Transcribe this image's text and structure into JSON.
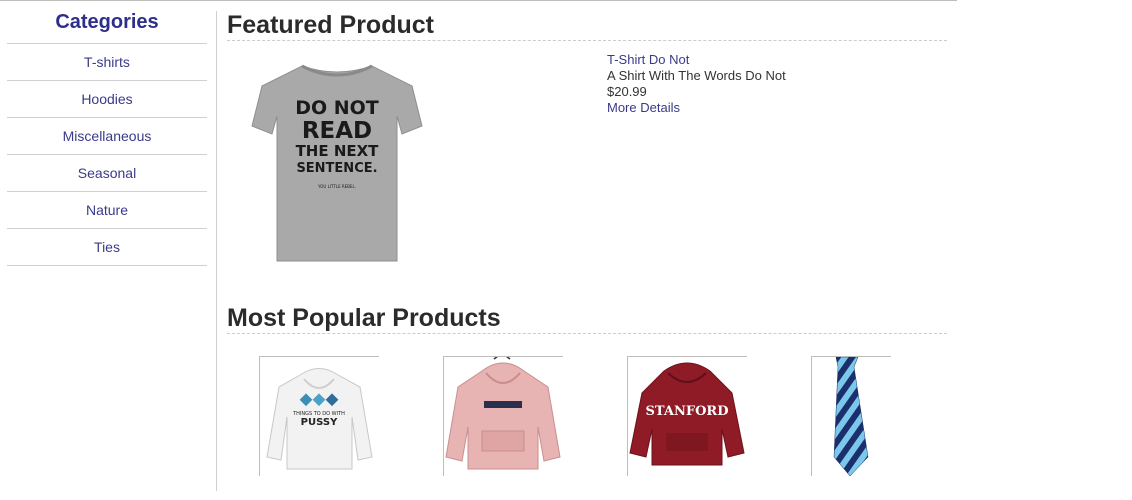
{
  "sidebar": {
    "title": "Categories",
    "items": [
      {
        "label": "T-shirts"
      },
      {
        "label": "Hoodies"
      },
      {
        "label": "Miscellaneous"
      },
      {
        "label": "Seasonal"
      },
      {
        "label": "Nature"
      },
      {
        "label": "Ties"
      }
    ]
  },
  "featured": {
    "section_title": "Featured Product",
    "image": {
      "alt": "grey t-shirt",
      "print_line1": "DO NOT",
      "print_line2": "READ",
      "print_line3": "THE NEXT",
      "print_line4": "SENTENCE.",
      "print_small": "YOU LITTLE REBEL."
    },
    "name": "T-Shirt Do Not",
    "description": "A Shirt With The Words Do Not",
    "price": "$20.99",
    "details_link": "More Details"
  },
  "popular": {
    "section_title": "Most Popular Products",
    "items": [
      {
        "alt": "white hoodie",
        "print_top": "THINGS TO DO WITH",
        "print_bottom": "PUSSY"
      },
      {
        "alt": "pink hoodie"
      },
      {
        "alt": "red hoodie",
        "print": "STANFORD"
      },
      {
        "alt": "striped tie"
      }
    ]
  },
  "colors": {
    "link": "#3a3a8a",
    "heading": "#2b2b2b",
    "category_title": "#2e2e8c"
  }
}
